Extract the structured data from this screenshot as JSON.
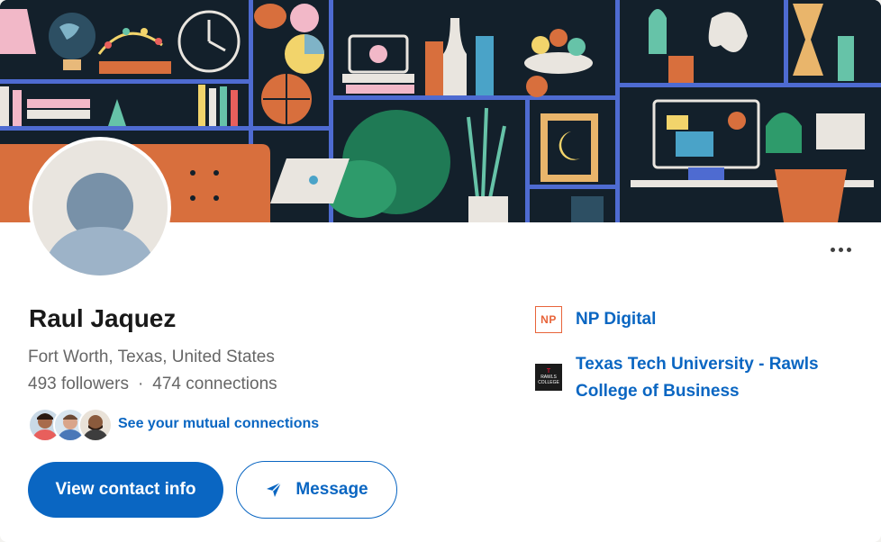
{
  "profile": {
    "name": "Raul Jaquez",
    "location": "Fort Worth, Texas, United States",
    "followers": "493 followers",
    "separator": "·",
    "connections": "474 connections",
    "mutual_link": "See your mutual connections"
  },
  "actions": {
    "primary_label": "View contact info",
    "message_label": "Message"
  },
  "organizations": [
    {
      "name": "NP Digital",
      "logo_text": "NP"
    },
    {
      "name_line1": "Texas Tech University - Rawls",
      "name_line2": "College of Business",
      "logo_text_1": "RAWLS",
      "logo_text_2": "COLLEGE"
    }
  ],
  "icons": {
    "more": "more-horizontal-icon",
    "message": "send-icon"
  },
  "colors": {
    "primary": "#0a66c2",
    "banner_bg": "#13202b",
    "np_orange": "#e8643a"
  }
}
